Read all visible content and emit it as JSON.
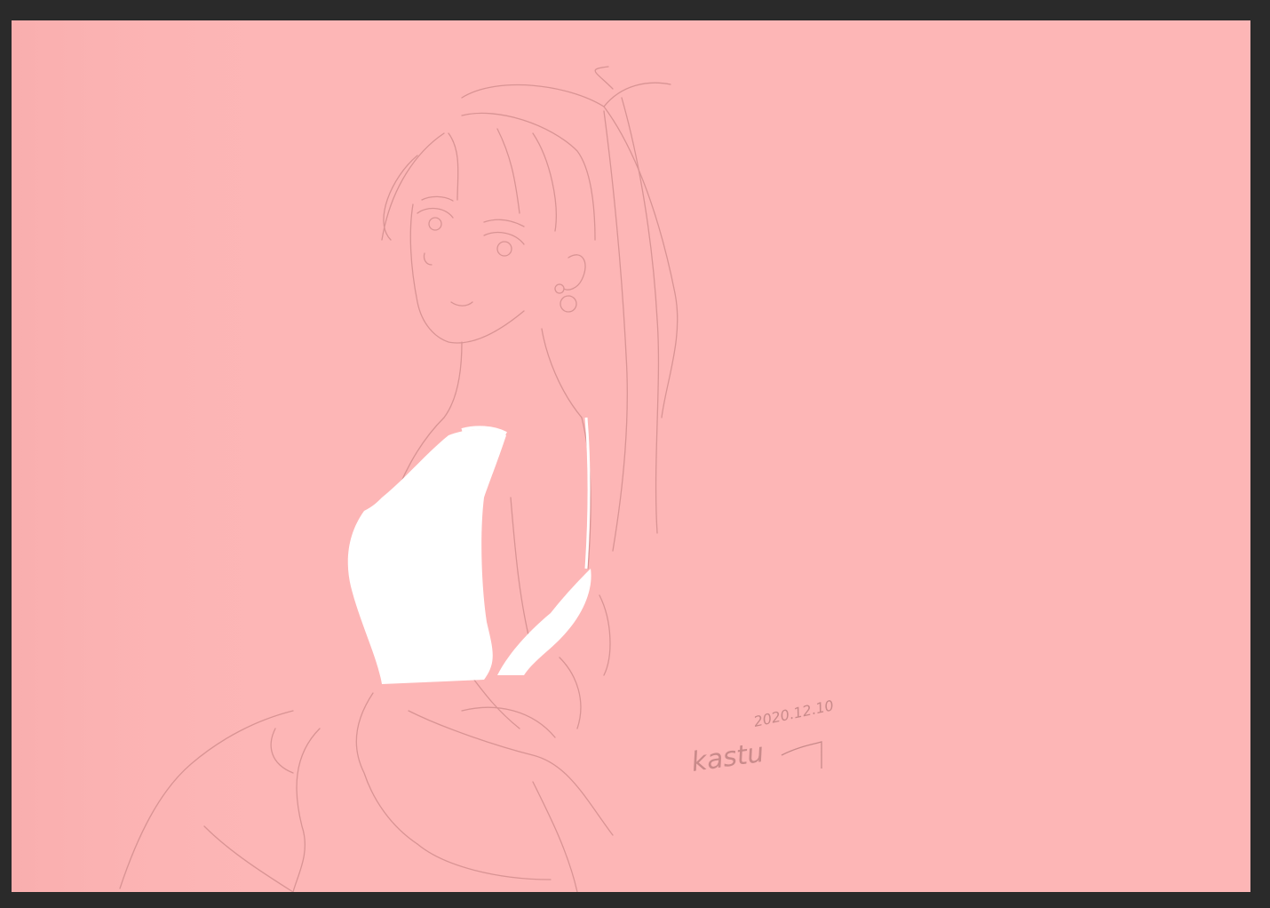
{
  "app": {
    "window_background": "#2a2a2a"
  },
  "canvas": {
    "paper_color": "#fdb6b6",
    "sketch_line_color": "#d68f8f",
    "top_fill_color": "#ffffff",
    "signature_name": "kastu",
    "signature_date": "2020.12.10"
  }
}
